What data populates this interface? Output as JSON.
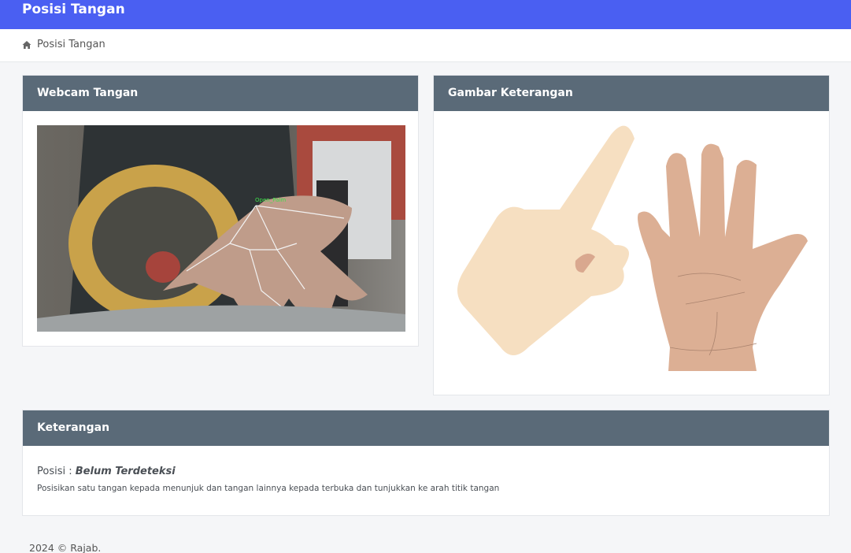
{
  "header": {
    "title": "Posisi Tangan"
  },
  "breadcrumb": {
    "icon": "home-icon",
    "label": "Posisi Tangan"
  },
  "webcam_card": {
    "title": "Webcam Tangan",
    "overlay_label": "Open_Palm"
  },
  "gambar_card": {
    "title": "Gambar Keterangan"
  },
  "keterangan_card": {
    "title": "Keterangan",
    "posisi_label": "Posisi :",
    "posisi_value": "Belum Terdeteksi",
    "description": "Posisikan satu tangan kepada menunjuk dan tangan lainnya kepada terbuka dan tunjukkan ke arah titik tangan"
  },
  "footer": {
    "text": "2024 © Rajab."
  },
  "colors": {
    "topbar": "#4a5ff2",
    "card_header": "#5a6a78",
    "background": "#f5f6f8"
  }
}
